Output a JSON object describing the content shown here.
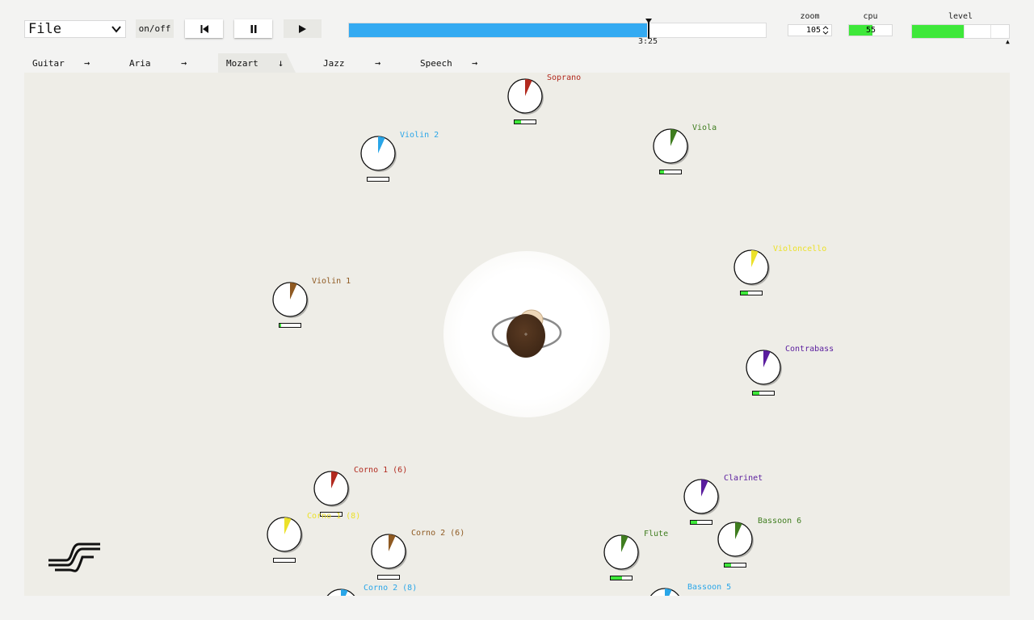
{
  "toolbar": {
    "file_label": "File",
    "onoff_label": "on/off",
    "progress_fraction": 0.716,
    "time_label": "3:25",
    "zoom_label": "zoom",
    "zoom_value": "105",
    "cpu_label": "cpu",
    "cpu_value": "55",
    "cpu_fraction": 0.55,
    "level_label": "level",
    "level_fraction": 0.53
  },
  "tabs": [
    {
      "label": "Guitar",
      "arrow": "→",
      "active": false
    },
    {
      "label": "Aria",
      "arrow": "→",
      "active": false
    },
    {
      "label": "Mozart",
      "arrow": "↓",
      "active": true
    },
    {
      "label": "Jazz",
      "arrow": "→",
      "active": false
    },
    {
      "label": "Speech",
      "arrow": "→",
      "active": false
    }
  ],
  "sources": [
    {
      "name": "Soprano",
      "color": "#b22a1f",
      "meter": 0.3
    },
    {
      "name": "Violin 2",
      "color": "#2aa6e8",
      "meter": 0.0
    },
    {
      "name": "Viola",
      "color": "#3f7d1f",
      "meter": 0.2
    },
    {
      "name": "Violoncello",
      "color": "#ece12a",
      "meter": 0.35
    },
    {
      "name": "Violin 1",
      "color": "#8f5a22",
      "meter": 0.08
    },
    {
      "name": "Contrabass",
      "color": "#5a1d9e",
      "meter": 0.3
    },
    {
      "name": "Corno 1 (6)",
      "color": "#b22a1f",
      "meter": 0.0
    },
    {
      "name": "Clarinet",
      "color": "#5a1d9e",
      "meter": 0.3
    },
    {
      "name": "Corno 1 (8)",
      "color": "#ece12a",
      "meter": 0.0
    },
    {
      "name": "Bassoon 6",
      "color": "#3f7d1f",
      "meter": 0.3
    },
    {
      "name": "Corno 2 (6)",
      "color": "#8f5a22",
      "meter": 0.0
    },
    {
      "name": "Flute",
      "color": "#3f7d1f",
      "meter": 0.55
    },
    {
      "name": "Corno 2 (8)",
      "color": "#2aa6e8",
      "meter": 0.0
    },
    {
      "name": "Bassoon 5",
      "color": "#2aa6e8",
      "meter": 0.0
    }
  ]
}
